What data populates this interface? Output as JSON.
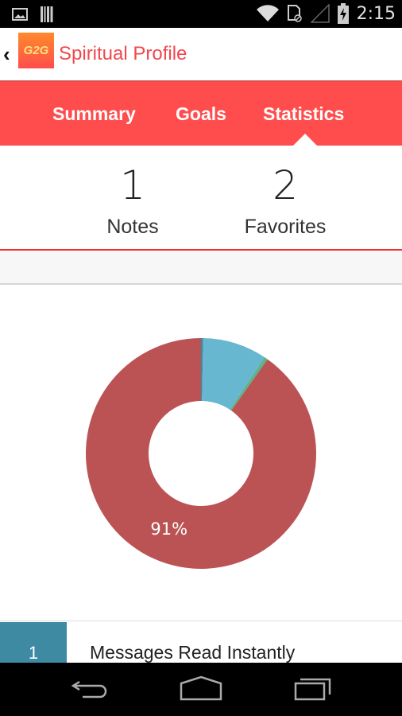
{
  "status_bar": {
    "time": "2:15",
    "icons": [
      "image-notification-icon",
      "barcode-notification-icon",
      "wifi-icon",
      "sim-blocked-icon",
      "no-signal-icon",
      "battery-charging-icon"
    ]
  },
  "app_bar": {
    "back_icon": "chevron-left-icon",
    "logo_text": "G2G",
    "title": "Spiritual Profile"
  },
  "tabs": [
    {
      "label": "Summary",
      "active": false
    },
    {
      "label": "Goals",
      "active": false
    },
    {
      "label": "Statistics",
      "active": true
    }
  ],
  "stats": [
    {
      "value": "1",
      "label": "Notes"
    },
    {
      "value": "2",
      "label": "Favorites"
    }
  ],
  "colors": {
    "accent": "#ff4d4e",
    "title": "#f1484e",
    "slice_main": "#bb5355",
    "slice_light_blue": "#68b7d0",
    "slice_dark_blue": "#3e8aa3",
    "slice_green": "#5db38a"
  },
  "chart_data": {
    "type": "pie",
    "donut": true,
    "start_angle": "12 o'clock, clockwise",
    "slices": [
      {
        "name": "Messages Read Instantly",
        "value": 0.3,
        "color": "#3e8aa3"
      },
      {
        "name": "slice-light-blue",
        "value": 9.0,
        "color": "#68b7d0"
      },
      {
        "name": "slice-green",
        "value": 0.5,
        "color": "#5db38a"
      },
      {
        "name": "slice-main",
        "value": 90.2,
        "color": "#bb5355",
        "label": "91%"
      }
    ]
  },
  "legend": [
    {
      "count": "1",
      "label": "Messages Read Instantly",
      "color": "#3e8aa3"
    }
  ],
  "nav_bar": {
    "buttons": [
      "back-icon",
      "home-icon",
      "recents-icon"
    ]
  }
}
